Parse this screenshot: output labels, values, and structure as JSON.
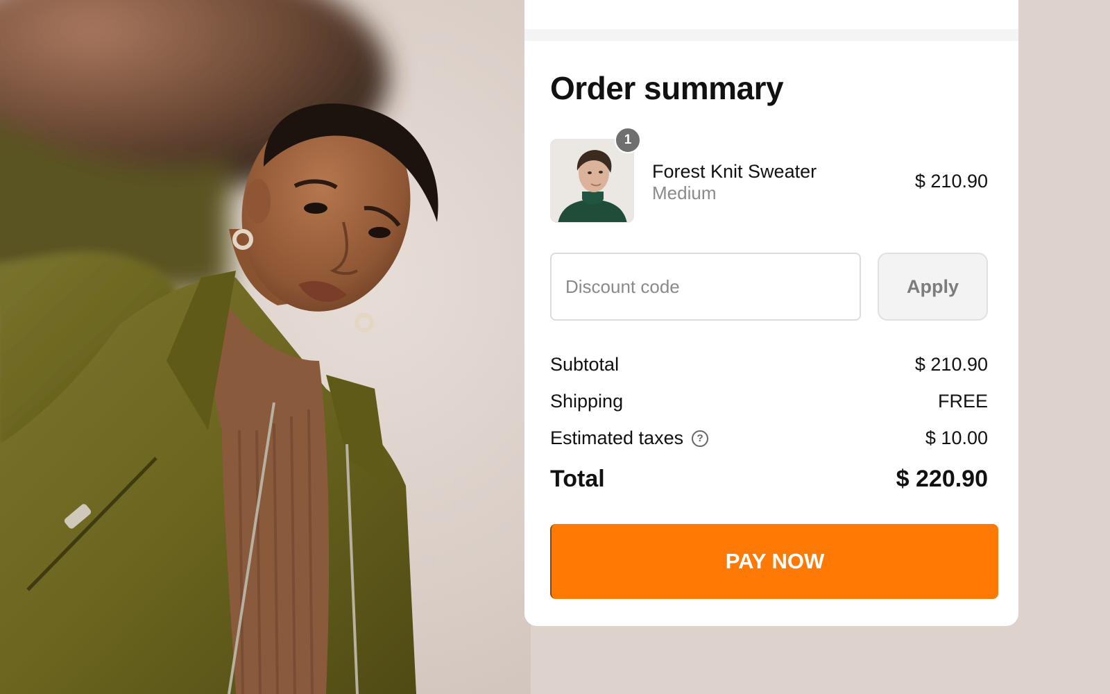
{
  "order_summary": {
    "title": "Order summary",
    "item": {
      "quantity": "1",
      "name": "Forest Knit Sweater",
      "variant": "Medium",
      "price": "$ 210.90"
    },
    "discount": {
      "placeholder": "Discount code",
      "value": "",
      "apply_label": "Apply"
    },
    "rows": {
      "subtotal_label": "Subtotal",
      "subtotal_value": "$ 210.90",
      "shipping_label": "Shipping",
      "shipping_value": "FREE",
      "taxes_label": "Estimated taxes",
      "taxes_value": "$ 10.00",
      "total_label": "Total",
      "total_value": "$ 220.90"
    },
    "help_icon_glyph": "?",
    "pay_label": "PAY NOW"
  },
  "colors": {
    "accent": "#fe7a05",
    "page_background": "#ddd2cc",
    "badge": "#6f6f6f"
  },
  "icons": {
    "help": "question-circle-icon"
  }
}
